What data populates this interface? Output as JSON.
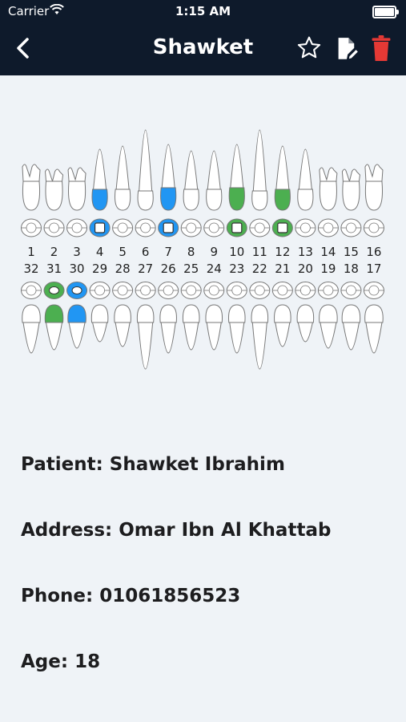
{
  "status_bar": {
    "carrier": "Carrier",
    "time": "1:15 AM"
  },
  "header": {
    "title": "Shawket",
    "back_icon": "chevron-left-icon",
    "favorite_icon": "star-icon",
    "edit_icon": "edit-note-icon",
    "delete_icon": "trash-icon"
  },
  "colors": {
    "header_bg": "#0e1a2b",
    "page_bg": "#eff3f7",
    "delete_red": "#e53935",
    "treated_blue": "#2196f3",
    "treated_green": "#4caf50"
  },
  "teeth": {
    "upper_numbers": [
      "1",
      "2",
      "3",
      "4",
      "5",
      "6",
      "7",
      "8",
      "9",
      "10",
      "11",
      "12",
      "13",
      "14",
      "15",
      "16"
    ],
    "lower_numbers": [
      "32",
      "31",
      "30",
      "29",
      "28",
      "27",
      "26",
      "25",
      "24",
      "23",
      "22",
      "21",
      "20",
      "19",
      "18",
      "17"
    ],
    "marked": [
      {
        "tooth": "4",
        "color": "blue"
      },
      {
        "tooth": "7",
        "color": "blue"
      },
      {
        "tooth": "10",
        "color": "green"
      },
      {
        "tooth": "12",
        "color": "green"
      },
      {
        "tooth": "31",
        "color": "green"
      },
      {
        "tooth": "30",
        "color": "blue"
      }
    ]
  },
  "patient": {
    "name": "Patient: Shawket Ibrahim",
    "address": "Address: Omar Ibn Al Khattab",
    "phone": "Phone: 01061856523",
    "age": "Age: 18"
  }
}
